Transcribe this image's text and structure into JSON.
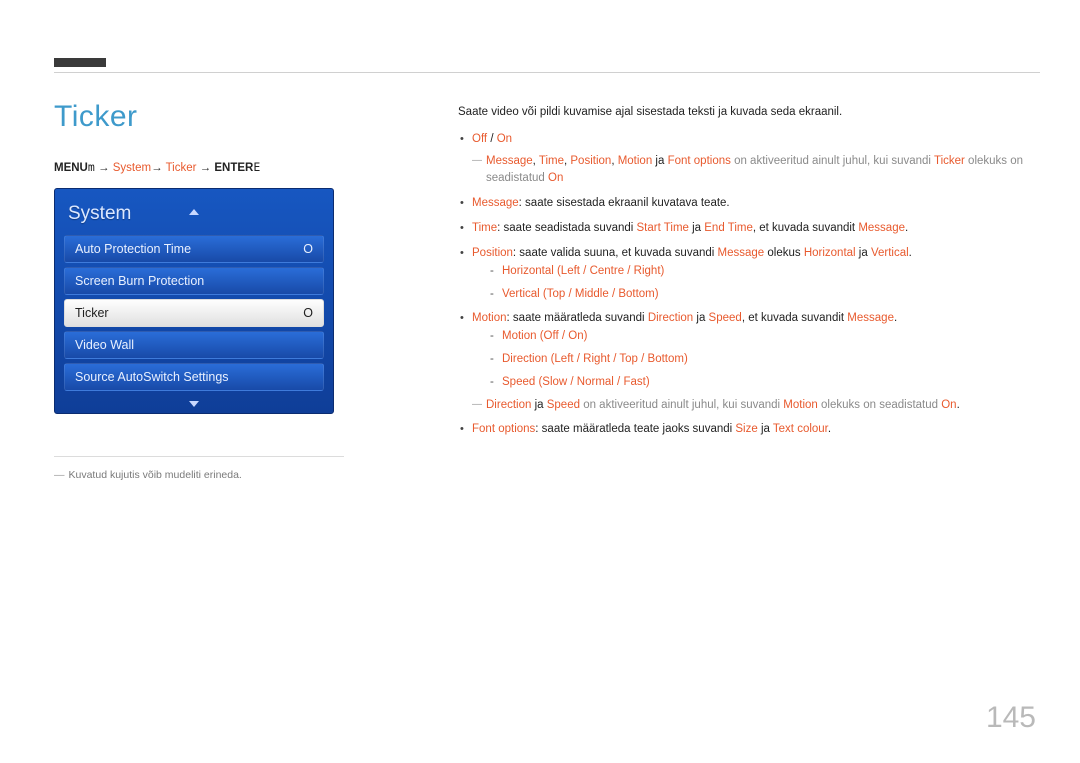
{
  "heading": "Ticker",
  "path": {
    "menu": "MENU",
    "system": "System",
    "ticker": "Ticker",
    "enter": "ENTER",
    "arrow": "→"
  },
  "panel": {
    "title": "System",
    "items": [
      {
        "label": "Auto Protection Time",
        "value": "O",
        "selected": false
      },
      {
        "label": "Screen Burn Protection",
        "value": "",
        "selected": false
      },
      {
        "label": "Ticker",
        "value": "O",
        "selected": true
      },
      {
        "label": "Video Wall",
        "value": "",
        "selected": false
      },
      {
        "label": "Source AutoSwitch Settings",
        "value": "",
        "selected": false
      }
    ]
  },
  "footnote": "Kuvatud kujutis võib mudeliti erineda.",
  "intro": "Saate video või pildi kuvamise ajal sisestada teksti ja kuvada seda ekraanil.",
  "body": {
    "offon": {
      "off": "Off",
      "sep": " / ",
      "on": "On"
    },
    "dash1a": {
      "t1": "Message",
      "t2": "Time",
      "t3": "Position",
      "t4": "Motion",
      "ja": " ja ",
      "t5": "Font options",
      "mid": " on aktiveeritud ainult juhul, kui suvandi ",
      "t6": "Ticker",
      "tail": " olekuks on seadistatud ",
      "t7": "On",
      "comma": ", "
    },
    "message": {
      "k": "Message",
      "rest": ": saate sisestada ekraanil kuvatava teate."
    },
    "time": {
      "k": "Time",
      "p1": ": saate seadistada suvandi ",
      "k2": "Start Time",
      "ja": " ja ",
      "k3": "End Time",
      "p2": ", et kuvada suvandit ",
      "k4": "Message",
      "dot": "."
    },
    "position": {
      "k": "Position",
      "p1": ": saate valida suuna, et kuvada suvandi ",
      "k2": "Message",
      "p2": " olekus ",
      "k3": "Horizontal",
      "ja": " ja ",
      "k4": "Vertical",
      "dot": "."
    },
    "pos_sub": {
      "h": "Horizontal",
      "h_vals": " (Left / Centre / Right)",
      "v": "Vertical",
      "v_vals": " (Top / Middle / Bottom)"
    },
    "motion": {
      "k": "Motion",
      "p1": ": saate määratleda suvandi ",
      "k2": "Direction",
      "ja": " ja ",
      "k3": "Speed",
      "p2": ", et kuvada suvandit ",
      "k4": "Message",
      "dot": "."
    },
    "motion_sub": {
      "m": "Motion",
      "m_vals": " (Off / On)",
      "d": "Direction",
      "d_vals": " (Left / Right / Top / Bottom)",
      "s": "Speed",
      "s_vals": " (Slow / Normal / Fast)"
    },
    "dash2": {
      "k1": "Direction",
      "ja": " ja ",
      "k2": "Speed",
      "mid": " on aktiveeritud ainult juhul, kui suvandi ",
      "k3": "Motion",
      "tail": " olekuks on seadistatud ",
      "k4": "On",
      "dot": "."
    },
    "font": {
      "k": "Font options",
      "p1": ": saate määratleda teate jaoks suvandi ",
      "k2": "Size",
      "ja": " ja ",
      "k3": "Text colour",
      "dot": "."
    }
  },
  "page": "145"
}
